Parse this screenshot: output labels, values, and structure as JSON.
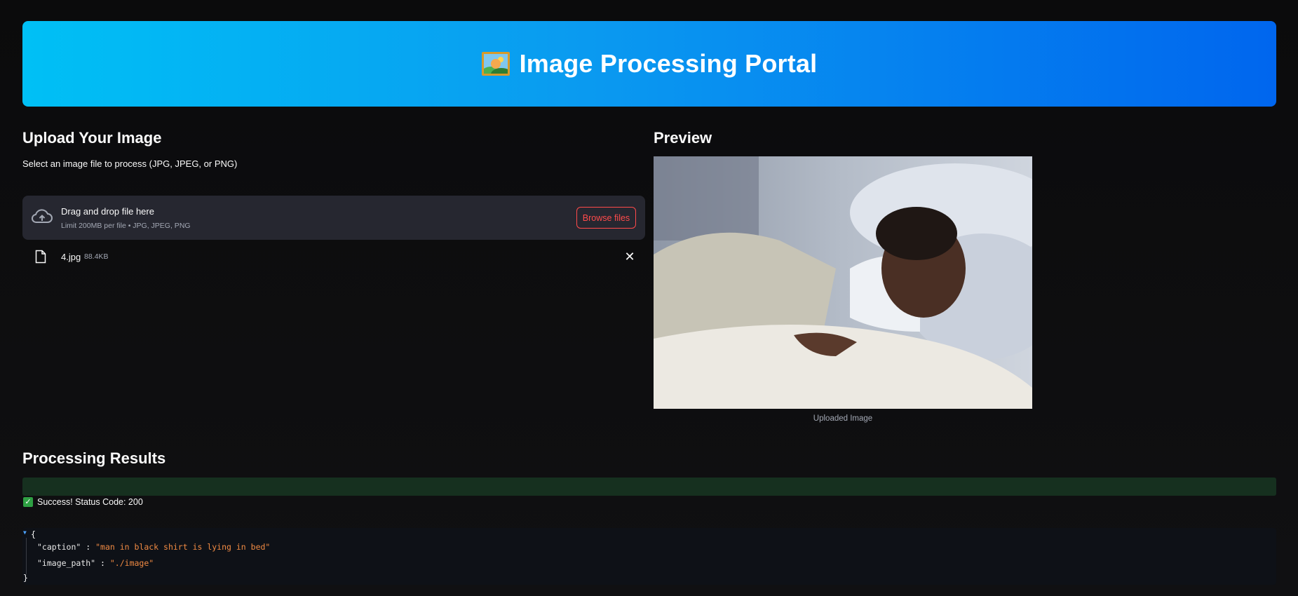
{
  "header": {
    "title": "Image Processing Portal",
    "icon": "framed-picture-icon"
  },
  "upload": {
    "heading": "Upload Your Image",
    "instructions": "Select an image file to process (JPG, JPEG, or PNG)",
    "dropzone_title": "Drag and drop file here",
    "dropzone_limit": "Limit 200MB per file • JPG, JPEG, PNG",
    "browse_label": "Browse files",
    "file": {
      "name": "4.jpg",
      "size": "88.4KB"
    }
  },
  "preview": {
    "heading": "Preview",
    "caption": "Uploaded Image"
  },
  "results": {
    "heading": "Processing Results",
    "status_text": "Success! Status Code: 200",
    "json": {
      "open_brace": "{",
      "close_brace": "}",
      "caption_key": "\"caption\"",
      "caption_value": "\"man in black shirt is lying in bed\"",
      "image_path_key": "\"image_path\"",
      "image_path_value": "\"./image\"",
      "separator": " : "
    }
  },
  "colors": {
    "accent": "#ff4b4b",
    "header_gradient_start": "#00c0f5",
    "header_gradient_end": "#0066ee",
    "success": "#2ea043",
    "json_string": "#f08a43"
  }
}
